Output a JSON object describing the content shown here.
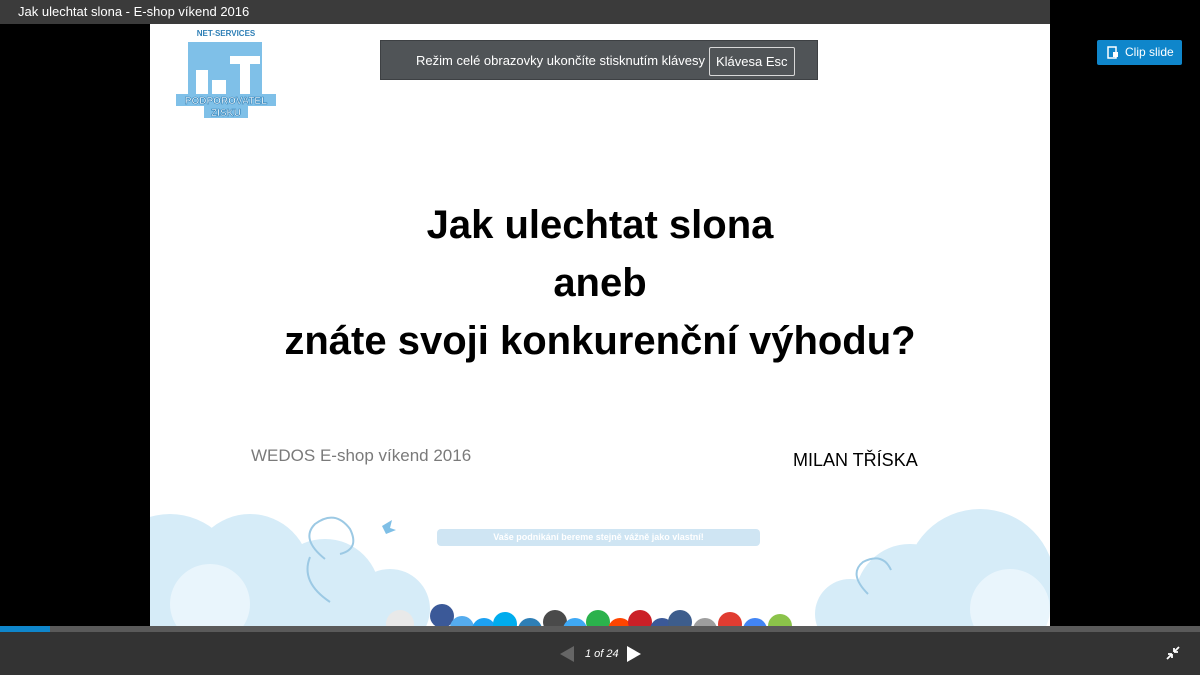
{
  "window": {
    "title": "Jak ulechtat slona - E-shop víkend 2016"
  },
  "fullscreen_notice": {
    "message": "Režim celé obrazovky ukončíte stisknutím klávesy",
    "key": "Klávesa Esc"
  },
  "logo": {
    "top_text": "NET-SERVICES",
    "line1": "PODPOROVATEL",
    "line2": "ZISKU"
  },
  "slide": {
    "title_lines": [
      "Jak ulechtat slona",
      "aneb",
      "znáte svoji konkurenční výhodu?"
    ],
    "event": "WEDOS E-shop víkend 2016",
    "author": "MILAN TŘÍSKA",
    "tagline": "Vaše podnikání bereme stejně vážně jako vlastní!"
  },
  "clip_button": {
    "label": "Clip slide",
    "icon": "clip-icon"
  },
  "player": {
    "counter": "1 of 24",
    "progress": 0.042,
    "prev_icon": "prev-arrow-icon",
    "next_icon": "next-arrow-icon",
    "exit_icon": "exit-fullscreen-icon"
  },
  "colors": {
    "accent": "#0f86cb",
    "chrome": "#333333",
    "notice_bg": "#505457"
  }
}
